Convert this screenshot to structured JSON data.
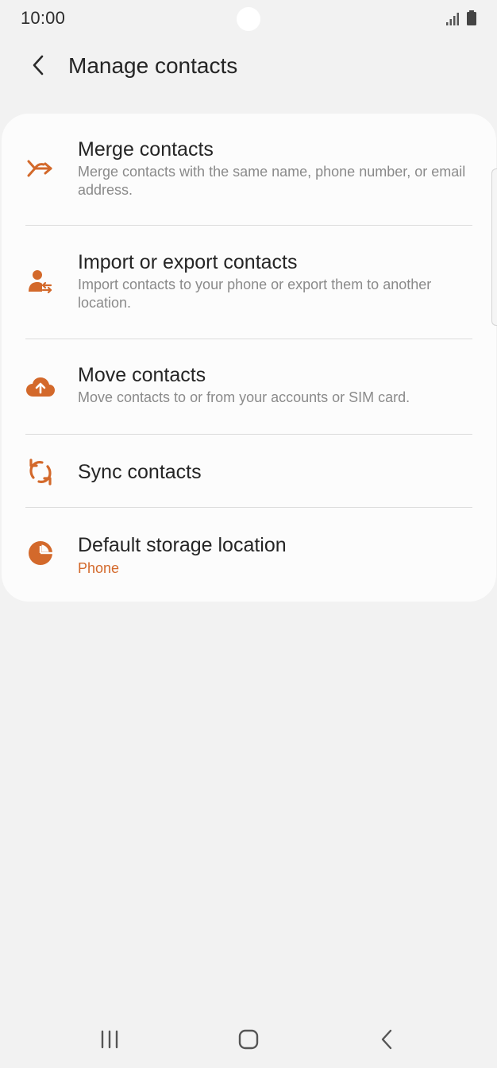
{
  "status_bar": {
    "time": "10:00",
    "icons": [
      "signal-icon",
      "battery-icon"
    ]
  },
  "header": {
    "title": "Manage contacts",
    "back_icon": "back-arrow-icon"
  },
  "accent_color": "#d3692b",
  "menu": {
    "items": [
      {
        "id": "merge",
        "icon": "merge-icon",
        "title": "Merge contacts",
        "description": "Merge contacts with the same name, phone number, or email address."
      },
      {
        "id": "import-export",
        "icon": "import-export-person-icon",
        "title": "Import or export contacts",
        "description": "Import contacts to your phone or export them to another location."
      },
      {
        "id": "move",
        "icon": "cloud-upload-icon",
        "title": "Move contacts",
        "description": "Move contacts to or from your accounts or SIM card."
      },
      {
        "id": "sync",
        "icon": "sync-icon",
        "title": "Sync contacts"
      },
      {
        "id": "storage",
        "icon": "storage-pie-icon",
        "title": "Default storage location",
        "value": "Phone"
      }
    ]
  },
  "nav_bar": {
    "buttons": [
      "recent-apps-icon",
      "home-icon",
      "back-icon"
    ]
  }
}
